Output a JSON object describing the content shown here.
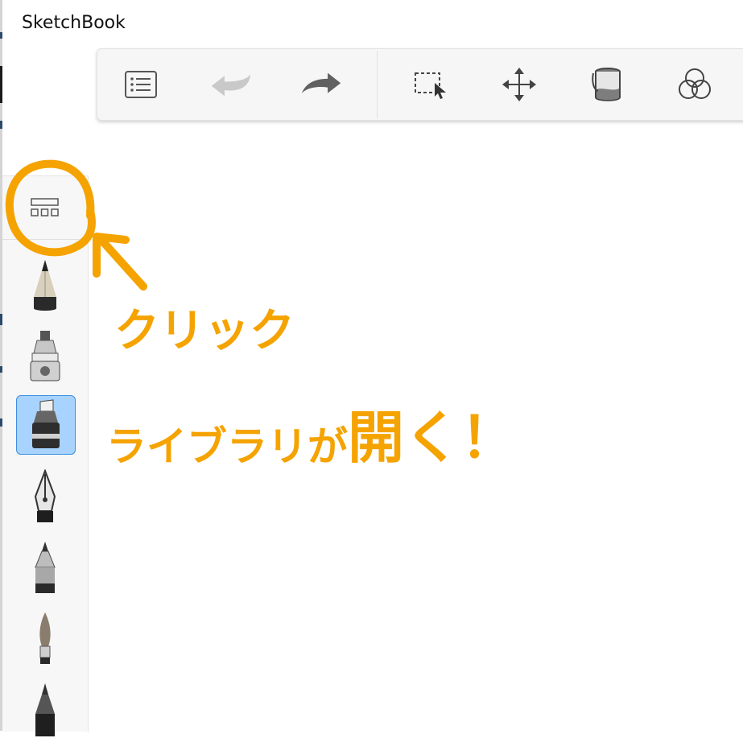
{
  "window": {
    "title": "SketchBook"
  },
  "toolbar": {
    "items": [
      {
        "name": "brush-list",
        "icon": "list-icon"
      },
      {
        "name": "undo",
        "icon": "undo-arrow-icon"
      },
      {
        "name": "redo",
        "icon": "redo-arrow-icon"
      },
      {
        "name": "selection",
        "icon": "selection-icon"
      },
      {
        "name": "transform",
        "icon": "move-arrows-icon"
      },
      {
        "name": "fill",
        "icon": "paint-bucket-icon"
      },
      {
        "name": "color-editor",
        "icon": "color-circles-icon"
      }
    ]
  },
  "sidebar": {
    "library_button": {
      "icon": "brush-library-icon"
    },
    "brushes": [
      {
        "name": "pencil",
        "selected": false
      },
      {
        "name": "airbrush",
        "selected": false
      },
      {
        "name": "marker",
        "selected": true
      },
      {
        "name": "inking-pen",
        "selected": false
      },
      {
        "name": "ballpoint-pen",
        "selected": false
      },
      {
        "name": "paintbrush",
        "selected": false
      },
      {
        "name": "technical-pen",
        "selected": false
      }
    ]
  },
  "annotation": {
    "color": "#f5a300",
    "line1": "クリック",
    "line2_part1": "ライブラリが",
    "line2_part2": "開く！"
  }
}
